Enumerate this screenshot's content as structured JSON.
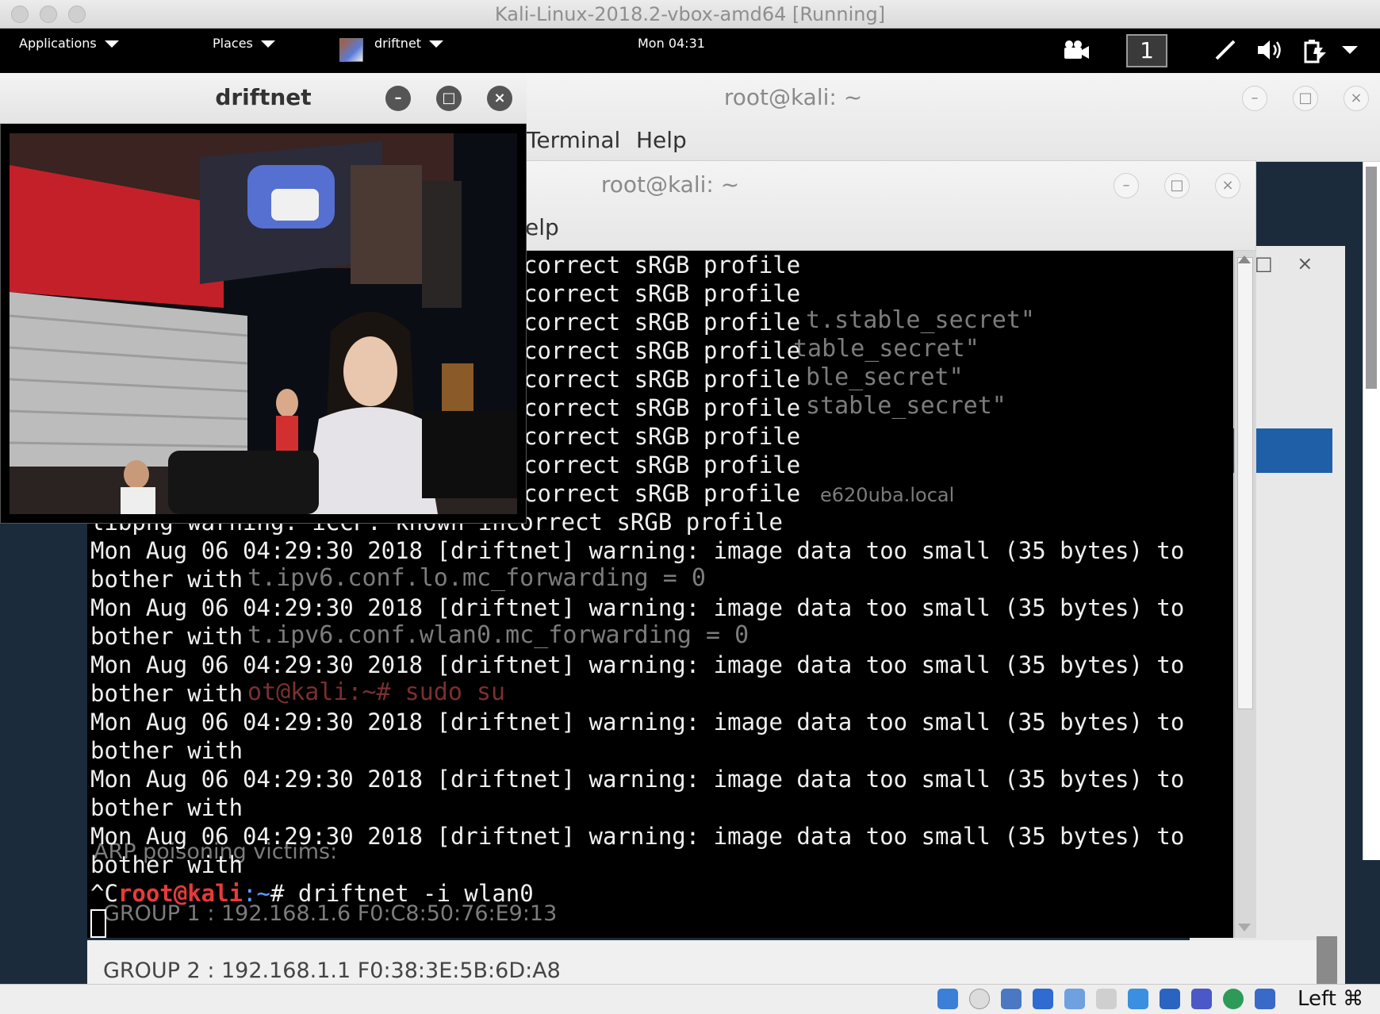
{
  "host": {
    "title": "Kali-Linux-2018.2-vbox-amd64 [Running]",
    "status_key": "Left ⌘"
  },
  "panel": {
    "applications": "Applications",
    "places": "Places",
    "active_app": "driftnet",
    "clock": "Mon 04:31",
    "workspace": "1"
  },
  "term_back": {
    "title": "root@kali: ~",
    "menu_terminal": "Terminal",
    "menu_help": "Help"
  },
  "term_front": {
    "title": "root@kali: ~",
    "menu_help_partial": "elp"
  },
  "driftnet_window": {
    "title": "driftnet"
  },
  "background_text": {
    "line1": "t.stable_secret\"",
    "line2": "table_secret\"",
    "line3": "ble_secret\"",
    "line4": "stable_secret\"",
    "line5": "t.ipv6.conf.lo.mc_forwarding = 0",
    "line6": "t.ipv6.conf.wlan0.mc_forwarding = 0",
    "line7": "ot@kali:~# sudo su",
    "line8": "ARP poisoning victims:",
    "line9": "GROUP 1 : 192.168.1.6 F0:C8:50:76:E9:13",
    "line10": "GROUP 2 : 192.168.1.1 F0:38:3E:5B:6D:A8",
    "line11": "e620uba.local"
  },
  "terminal_lines": {
    "srgb": [
      "correct sRGB profile",
      "correct sRGB profile",
      "correct sRGB profile",
      "correct sRGB profile",
      "correct sRGB profile",
      "correct sRGB profile",
      "correct sRGB profile",
      "correct sRGB profile",
      "correct sRGB profile"
    ],
    "libpng": "libpng warning: iCCP: known incorrect sRGB profile",
    "warn_head": "Mon Aug 06 04:29:30 2018 [driftnet] warning: image data too small (35 bytes) to",
    "warn_tail": "bother with",
    "prompt_prefix": "^C",
    "prompt_user": "root@kali",
    "prompt_path": ":~",
    "prompt_cmd": "# driftnet -i wlan0"
  },
  "colors": {
    "prompt_red": "#e83a3a",
    "prompt_blue": "#5aa0ff"
  }
}
